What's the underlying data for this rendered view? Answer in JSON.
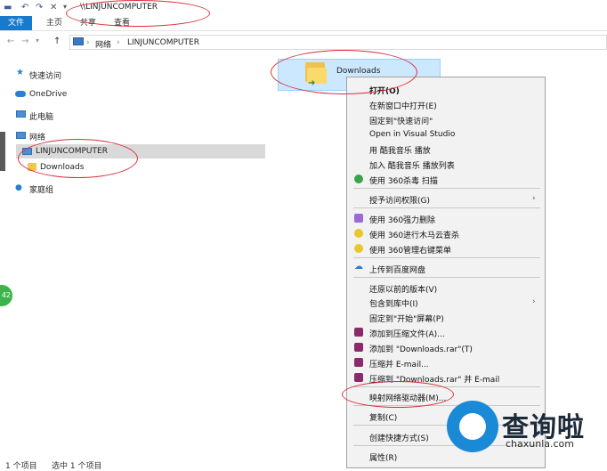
{
  "window": {
    "title": "\\\\LINJUNCOMPUTER"
  },
  "ribbon": {
    "tabs": [
      "文件",
      "主页",
      "共享",
      "查看"
    ]
  },
  "address": {
    "crumbs": [
      "网络",
      "LINJUNCOMPUTER"
    ]
  },
  "nav_pane": {
    "quick_access": "快速访问",
    "onedrive": "OneDrive",
    "this_pc": "此电脑",
    "network": "网络",
    "computer": "LINJUNCOMPUTER",
    "downloads": "Downloads",
    "homegroup": "家庭组"
  },
  "content": {
    "item_name": "Downloads"
  },
  "context_menu": {
    "open": "打开(O)",
    "open_new_window": "在新窗口中打开(E)",
    "pin_quick": "固定到\"快速访问\"",
    "open_vs": "Open in Visual Studio",
    "kugou_play": "用 酷我音乐 播放",
    "kugou_add": "加入 酷我音乐 播放列表",
    "scan_360": "使用 360杀毒 扫描",
    "give_access": "授予访问权限(G)",
    "force_delete": "使用 360强力删除",
    "trojan_scan": "使用 360进行木马云查杀",
    "manage_menu": "使用 360管理右键菜单",
    "upload_baidu": "上传到百度网盘",
    "restore_prev": "还原以前的版本(V)",
    "include_lib": "包含到库中(I)",
    "pin_start": "固定到\"开始\"屏幕(P)",
    "add_archive": "添加到压缩文件(A)...",
    "add_rar": "添加到 \"Downloads.rar\"(T)",
    "compress_email": "压缩并 E-mail...",
    "compress_rar_email": "压缩到 \"Downloads.rar\" 并 E-mail",
    "map_drive": "映射网络驱动器(M)...",
    "copy": "复制(C)",
    "create_shortcut": "创建快捷方式(S)",
    "properties": "属性(R)"
  },
  "status": {
    "count": "1 个项目",
    "selected": "选中 1 个项目"
  },
  "watermark": {
    "brand": "查询啦",
    "domain": "chaxunla.com"
  },
  "side_badge": "42"
}
